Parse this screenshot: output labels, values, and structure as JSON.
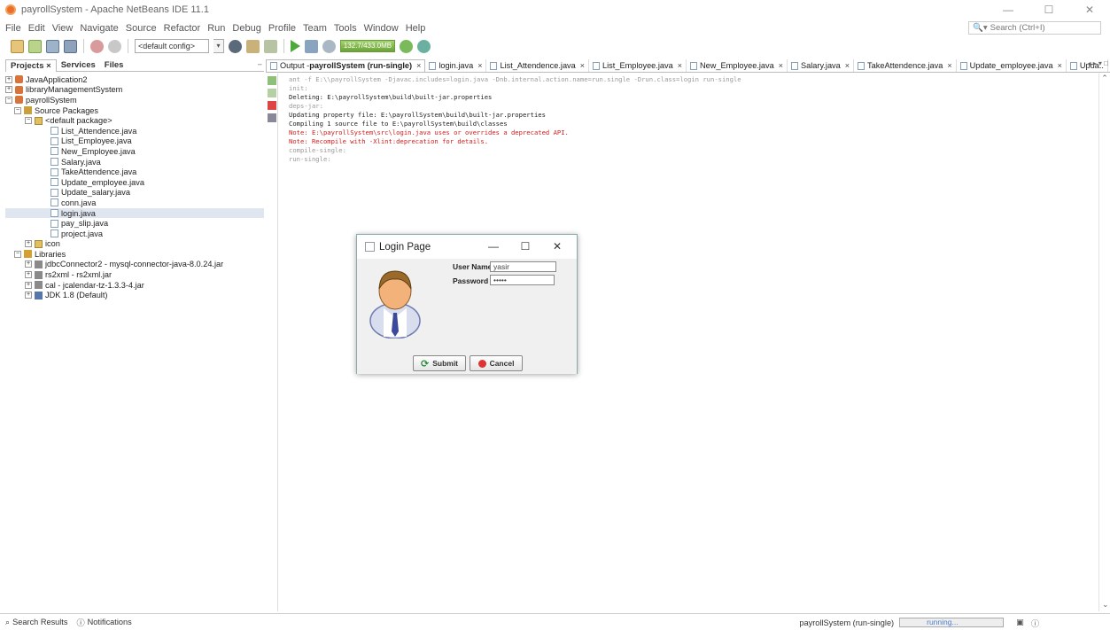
{
  "window": {
    "title": "payrollSystem - Apache NetBeans IDE 11.1",
    "min": "—",
    "max": "☐",
    "close": "✕"
  },
  "menu": [
    "File",
    "Edit",
    "View",
    "Navigate",
    "Source",
    "Refactor",
    "Run",
    "Debug",
    "Profile",
    "Team",
    "Tools",
    "Window",
    "Help"
  ],
  "search": {
    "placeholder": "Search (Ctrl+I)"
  },
  "toolbar": {
    "config": "<default config>",
    "memory": "132.7/433.0MB"
  },
  "left_panel": {
    "tabs": [
      "Projects",
      "Services",
      "Files"
    ],
    "close_x": "×",
    "minimize": "−",
    "tree": [
      {
        "label": "JavaApplication2",
        "exp": "+",
        "indent": 0,
        "icon": "project"
      },
      {
        "label": "libraryManagementSystem",
        "exp": "+",
        "indent": 0,
        "icon": "project"
      },
      {
        "label": "payrollSystem",
        "exp": "−",
        "indent": 0,
        "icon": "project"
      },
      {
        "label": "Source Packages",
        "exp": "−",
        "indent": 1,
        "icon": "package-root"
      },
      {
        "label": "<default package>",
        "exp": "−",
        "indent": 2,
        "icon": "package"
      },
      {
        "label": "List_Attendence.java",
        "exp": "",
        "indent": 3,
        "icon": "java"
      },
      {
        "label": "List_Employee.java",
        "exp": "",
        "indent": 3,
        "icon": "java"
      },
      {
        "label": "New_Employee.java",
        "exp": "",
        "indent": 3,
        "icon": "java"
      },
      {
        "label": "Salary.java",
        "exp": "",
        "indent": 3,
        "icon": "java"
      },
      {
        "label": "TakeAttendence.java",
        "exp": "",
        "indent": 3,
        "icon": "java"
      },
      {
        "label": "Update_employee.java",
        "exp": "",
        "indent": 3,
        "icon": "java"
      },
      {
        "label": "Update_salary.java",
        "exp": "",
        "indent": 3,
        "icon": "java"
      },
      {
        "label": "conn.java",
        "exp": "",
        "indent": 3,
        "icon": "java"
      },
      {
        "label": "login.java",
        "exp": "",
        "indent": 3,
        "icon": "java",
        "selected": true
      },
      {
        "label": "pay_slip.java",
        "exp": "",
        "indent": 3,
        "icon": "java"
      },
      {
        "label": "project.java",
        "exp": "",
        "indent": 3,
        "icon": "java"
      },
      {
        "label": "icon",
        "exp": "+",
        "indent": 2,
        "icon": "package"
      },
      {
        "label": "Libraries",
        "exp": "−",
        "indent": 1,
        "icon": "libraries"
      },
      {
        "label": "jdbcConnector2 - mysql-connector-java-8.0.24.jar",
        "exp": "+",
        "indent": 2,
        "icon": "lib"
      },
      {
        "label": "rs2xml - rs2xml.jar",
        "exp": "+",
        "indent": 2,
        "icon": "lib"
      },
      {
        "label": "cal - jcalendar-tz-1.3.3-4.jar",
        "exp": "+",
        "indent": 2,
        "icon": "lib"
      },
      {
        "label": "JDK 1.8 (Default)",
        "exp": "+",
        "indent": 2,
        "icon": "jdk"
      }
    ]
  },
  "editor_tabs": [
    {
      "label": "Output - ",
      "bold": "payrollSystem (run-single)",
      "active": true
    },
    {
      "label": "login.java"
    },
    {
      "label": "List_Attendence.java"
    },
    {
      "label": "List_Employee.java"
    },
    {
      "label": "New_Employee.java"
    },
    {
      "label": "Salary.java"
    },
    {
      "label": "TakeAttendence.java"
    },
    {
      "label": "Update_employee.java"
    },
    {
      "label": "Upda.."
    }
  ],
  "tab_nav": "◂ ▸ ▾ □",
  "console": [
    {
      "text": "ant -f E:\\\\payrollSystem -Djavac.includes=login.java -Dnb.internal.action.name=run.single -Drun.class=login run-single",
      "color": "gray"
    },
    {
      "text": "init:",
      "color": "gray"
    },
    {
      "text": "Deleting: E:\\payrollSystem\\build\\built-jar.properties",
      "color": "black"
    },
    {
      "text": "deps-jar:",
      "color": "gray"
    },
    {
      "text": "Updating property file: E:\\payrollSystem\\build\\built-jar.properties",
      "color": "black"
    },
    {
      "text": "Compiling 1 source file to E:\\payrollSystem\\build\\classes",
      "color": "black"
    },
    {
      "text": "Note: E:\\payrollSystem\\src\\login.java uses or overrides a deprecated API.",
      "color": "red"
    },
    {
      "text": "Note: Recompile with -Xlint:deprecation for details.",
      "color": "red"
    },
    {
      "text": "compile-single:",
      "color": "gray"
    },
    {
      "text": "run-single:",
      "color": "gray"
    }
  ],
  "statusbar": {
    "search_results": "Search Results",
    "notifications": "Notifications",
    "task": "payrollSystem (run-single)",
    "progress_text": "running..."
  },
  "login_dialog": {
    "title": "Login Page",
    "min": "—",
    "max": "☐",
    "close": "✕",
    "username_label": "User Name",
    "username_value": "yasir",
    "password_label": "Password",
    "password_value": "•••••",
    "submit": "Submit",
    "cancel": "Cancel"
  }
}
